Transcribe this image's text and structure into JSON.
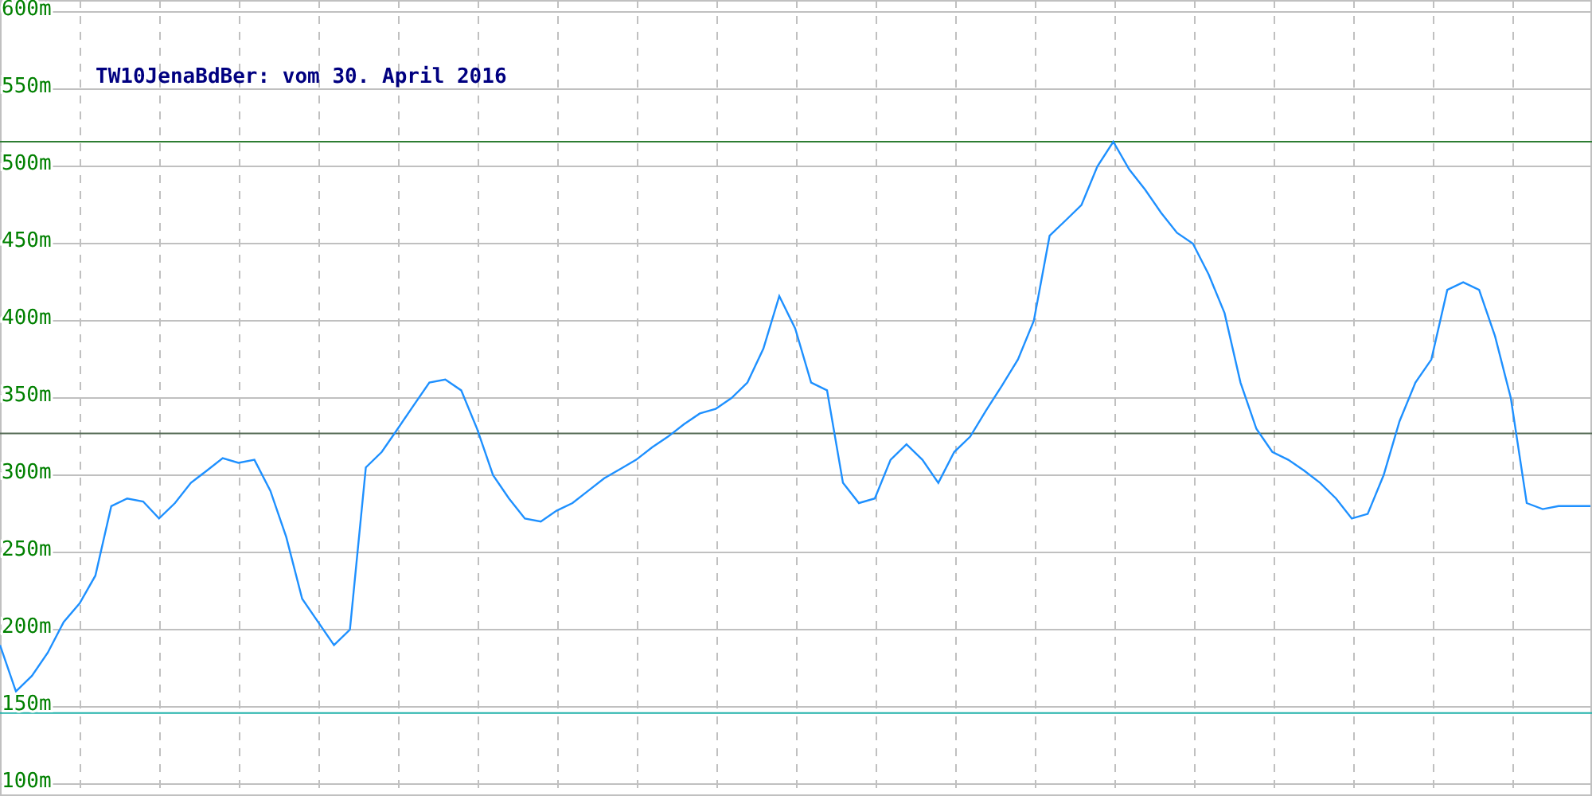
{
  "chart_data": {
    "type": "line",
    "title": "TW10JenaBdBer: vom 30. April 2016",
    "categories": [
      null,
      null,
      null,
      null,
      null,
      null,
      null,
      null,
      null,
      null,
      null,
      null,
      null,
      null,
      null,
      null,
      null,
      null,
      null,
      null,
      null,
      null,
      null,
      null,
      null,
      null,
      null,
      null,
      null,
      null,
      null,
      null,
      null,
      null,
      null,
      null,
      null,
      null,
      null,
      null,
      null,
      null,
      null,
      null,
      null,
      null,
      null,
      null,
      null,
      null,
      null,
      null,
      null,
      null,
      null,
      null,
      null,
      null,
      null,
      null,
      null,
      null,
      null,
      null,
      null,
      null,
      null,
      null,
      null,
      null,
      null,
      null,
      null,
      null,
      null,
      null,
      null,
      null,
      null,
      null,
      null,
      null,
      null,
      null,
      null,
      null,
      null,
      null,
      null,
      null,
      null,
      null,
      null,
      null,
      null,
      null,
      null,
      null,
      null,
      null,
      null
    ],
    "series": [
      {
        "color": "#1e90ff",
        "values": [
          190,
          160,
          170,
          185,
          205,
          217,
          235,
          280,
          285,
          283,
          272,
          282,
          295,
          303,
          311,
          308,
          310,
          290,
          260,
          220,
          205,
          190,
          200,
          305,
          315,
          330,
          345,
          360,
          362,
          355,
          330,
          300,
          285,
          272,
          270,
          277,
          282,
          290,
          298,
          304,
          310,
          318,
          325,
          333,
          340,
          343,
          350,
          360,
          382,
          416,
          395,
          360,
          355,
          295,
          282,
          285,
          310,
          320,
          310,
          295,
          315,
          325,
          342,
          358,
          375,
          400,
          455,
          465,
          475,
          500,
          516,
          498,
          485,
          470,
          457,
          450,
          430,
          405,
          360,
          330,
          315,
          310,
          303,
          295,
          285,
          272,
          275,
          300,
          335,
          360,
          375,
          420,
          425,
          420,
          390,
          350,
          282,
          278,
          280,
          280,
          280
        ]
      }
    ],
    "ylim": [
      100,
      600
    ],
    "yticks": [
      {
        "value": 100,
        "label": "100m"
      },
      {
        "value": 150,
        "label": "150m"
      },
      {
        "value": 200,
        "label": "200m"
      },
      {
        "value": 250,
        "label": "250m"
      },
      {
        "value": 300,
        "label": "300m"
      },
      {
        "value": 350,
        "label": "350m"
      },
      {
        "value": 400,
        "label": "400m"
      },
      {
        "value": 450,
        "label": "450m"
      },
      {
        "value": 500,
        "label": "500m"
      },
      {
        "value": 550,
        "label": "550m"
      },
      {
        "value": 600,
        "label": "600m"
      }
    ],
    "grid": true,
    "ref_lines": [
      {
        "axis": "y",
        "value": 516,
        "color": "#2e7d32"
      },
      {
        "axis": "y",
        "value": 327,
        "color": "#556b55"
      },
      {
        "axis": "y",
        "value": 146,
        "color": "#20b2aa"
      }
    ]
  }
}
